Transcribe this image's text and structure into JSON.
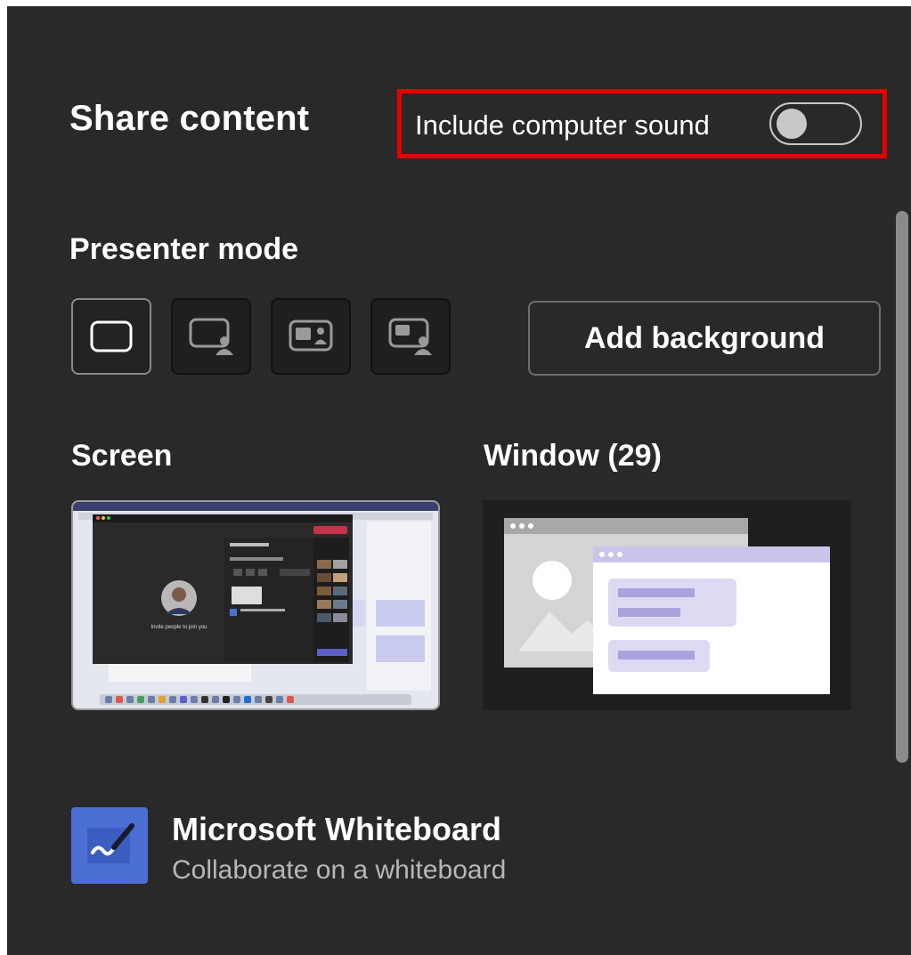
{
  "panel": {
    "title": "Share content",
    "include_sound": {
      "label": "Include computer sound",
      "enabled": false
    }
  },
  "presenter_mode": {
    "heading": "Presenter mode",
    "modes": [
      {
        "name": "content-only",
        "icon": "content-only-icon",
        "selected": true
      },
      {
        "name": "standout",
        "icon": "standout-icon",
        "selected": false
      },
      {
        "name": "side-by-side",
        "icon": "side-by-side-icon",
        "selected": false
      },
      {
        "name": "reporter",
        "icon": "reporter-icon",
        "selected": false
      }
    ],
    "add_background": "Add background"
  },
  "sources": {
    "screen_heading": "Screen",
    "window_heading": "Window (29)",
    "screen_thumb_caption": "Invite people to join you"
  },
  "whiteboard": {
    "title": "Microsoft Whiteboard",
    "subtitle": "Collaborate on a whiteboard"
  },
  "colors": {
    "panel_bg": "#292929",
    "highlight": "#e50000",
    "whiteboard_blue": "#4b6fd4",
    "window_purple": "#c9c5ea"
  }
}
